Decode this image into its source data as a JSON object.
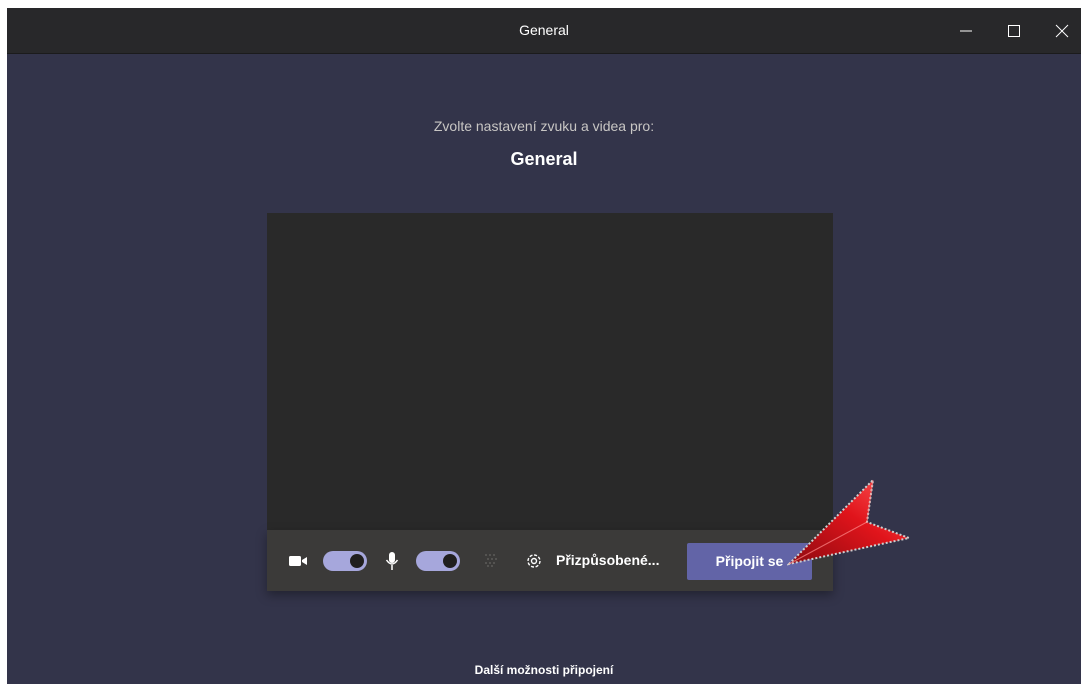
{
  "window": {
    "title": "General",
    "controls": {
      "minimize_icon": "minimize-icon",
      "maximize_icon": "maximize-icon",
      "close_icon": "close-icon"
    }
  },
  "prejoin": {
    "prompt": "Zvolte nastavení zvuku a videa pro:",
    "meeting_name": "General"
  },
  "controls": {
    "camera_icon": "camera-icon",
    "camera_toggle_on": true,
    "mic_icon": "microphone-icon",
    "mic_toggle_on": true,
    "background_effects_icon": "background-blur-icon",
    "settings_icon": "gear-icon",
    "device_settings_label": "Přizpůsobené...",
    "join_label": "Připojit se"
  },
  "footer": {
    "more_options": "Další možnosti připojení"
  },
  "colors": {
    "app_background": "#33344a",
    "titlebar": "#28282a",
    "preview": "#292929",
    "control_bar": "#3b3a39",
    "toggle_on": "#a6a7dc",
    "join_button": "#6264a7",
    "annotation_arrow": "#e0141b"
  }
}
